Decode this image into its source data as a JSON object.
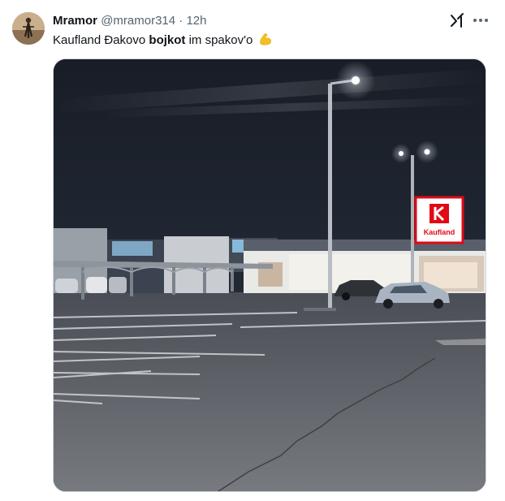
{
  "tweet": {
    "author_name": "Mramor",
    "author_handle": "@mramor314",
    "separator": "·",
    "time": "12h",
    "text_before": "Kaufland Đakovo ",
    "text_bold": "bojkot",
    "text_after": " im spakov'o",
    "emoji": "flexed-biceps"
  },
  "photo": {
    "sign_text": "Kaufland",
    "sign_color": "#e10915",
    "content": "night-parking-lot-photo"
  },
  "icons": {
    "grok": "grok-icon",
    "more": "more-icon"
  }
}
